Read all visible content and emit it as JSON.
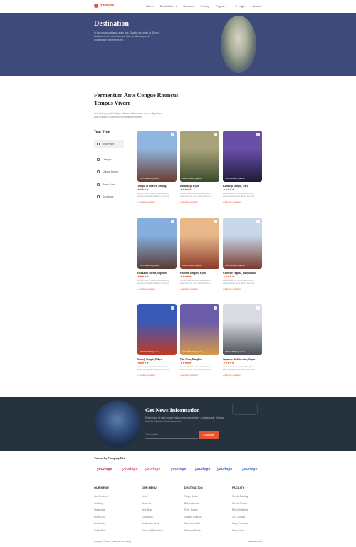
{
  "nav": {
    "logo": "travelyte",
    "menu": [
      {
        "label": "Home",
        "caret": ""
      },
      {
        "label": "Destination",
        "caret": "▾"
      },
      {
        "label": "Services",
        "caret": ""
      },
      {
        "label": "Pricing",
        "caret": ""
      },
      {
        "label": "Pages",
        "caret": "▾"
      }
    ],
    "login": "Login",
    "search": "Search"
  },
  "hero": {
    "title": "Destination",
    "desc": "In leo consequat lacus enim hac. Sagittis sed enim ut. Donec faucibus amet in consectetur. Nam at ullamcorper ut. Scelerisque elementum leo."
  },
  "section": {
    "title": "Fermentum Ante Congue Rhoncus Tempus Viverr",
    "desc": "Amet integer nisl tristique aliquam ullamcorper ut nec dignissim odio tincidunt in bibendum blandit elementum."
  },
  "tour_type": {
    "title": "Tour Type",
    "items": [
      {
        "label": "Best Place",
        "icon": "place-icon"
      },
      {
        "label": "Lifestyle",
        "icon": "lifestyle-icon"
      },
      {
        "label": "Unique Search",
        "icon": "search-icon"
      },
      {
        "label": "Prime Date",
        "icon": "calendar-icon"
      },
      {
        "label": "Adventure",
        "icon": "mountain-icon"
      }
    ]
  },
  "cards": [
    {
      "name": "Temple of Heaven, Beijing",
      "tag": "UNO BARRI Quezon",
      "stars": "★★★★★",
      "desc": "Lacus, diam sit elit condimentum euismod sed nunc libero. Dui nec",
      "explore": "Explore Location",
      "c1": "#8fb6e0",
      "c2": "#6b3b2c"
    },
    {
      "name": "Kinkakuji, Kyoto",
      "tag": "UNO BARRI Quezon",
      "stars": "★★★★★",
      "desc": "Lacus, diam sit elit condimentum euismod sed nunc libero. Dui nec",
      "explore": "Explore Location",
      "c1": "#a8a37a",
      "c2": "#3b4a2a"
    },
    {
      "name": "Kohku-ji Temple, Nara",
      "tag": "UNO BARRI Quezon",
      "stars": "★★★★★",
      "desc": "Lacus, diam sit elit condimentum euismod sed nunc libero. Dui nec",
      "explore": "Explore Location",
      "c1": "#6a4fa8",
      "c2": "#1e1a3a"
    },
    {
      "name": "Hokkaido Shrine, Sapporo",
      "tag": "UNO BARRI Quezon",
      "stars": "★★★★★",
      "desc": "Lacus, diam sit elit condimentum euismod sed nunc libero. Dui nec",
      "explore": "Explore Location",
      "c1": "#86aede",
      "c2": "#5a3a30"
    },
    {
      "name": "Phoenix Temples, Kyoto",
      "tag": "UNO BARRI Quezon",
      "stars": "★★★★★",
      "desc": "Lacus, diam sit elit condimentum euismod sed nunc libero. Dui nec",
      "explore": "Explore Location",
      "c1": "#e8b88a",
      "c2": "#8a3a2a"
    },
    {
      "name": "Chureito Pagoda, Fujiyoshida",
      "tag": "UNO BARRI Quezon",
      "stars": "★★★★★",
      "desc": "Lacus, diam sit elit condimentum euismod sed nunc libero. Dui nec",
      "explore": "Explore Location",
      "c1": "#c8d6ea",
      "c2": "#7a3a2e"
    },
    {
      "name": "Sensoji Temple, Tokyo",
      "tag": "UNO BARRI Quezon",
      "stars": "★★★★★",
      "desc": "Lacus, diam sit elit condimentum euismod sed nunc libero. Dui nec",
      "explore": "Explore Location",
      "c1": "#3a5ab8",
      "c2": "#c23a22"
    },
    {
      "name": "Wat Arun, Bangkok",
      "tag": "UNO BARRI Quezon",
      "stars": "★★★★★",
      "desc": "Lacus, diam sit elit condimentum euismod sed nunc libero. Dui nec",
      "explore": "Explore Location",
      "c1": "#6a5ca8",
      "c2": "#d89a4a"
    },
    {
      "name": "Japanese Architecture, Japan",
      "tag": "UNO BARRI Quezon",
      "stars": "★★★★★",
      "desc": "Lacus, diam sit elit condimentum euismod sed nunc libero. Dui nec",
      "explore": "Explore Location",
      "c1": "#d8dce2",
      "c2": "#4a4e56"
    }
  ],
  "news": {
    "title": "Get News Information",
    "desc": "Erat cursus ut eget ornare ullamcorper consectetur a egestas elit. Viverra lobortis faucibus felis tristique est.",
    "placeholder": "Your email ...",
    "button": "Subscribe"
  },
  "trusted": {
    "title": "Trusted by Company like",
    "logos": [
      {
        "label": "yourlogo",
        "color": "#c0396a"
      },
      {
        "label": "yourlogo",
        "color": "#d44a8a"
      },
      {
        "label": "yourlogo",
        "color": "#e85a8a"
      },
      {
        "label": "yourlogo",
        "color": "#7a5cc8"
      },
      {
        "label": "yourlogo",
        "color": "#4a5ab8"
      },
      {
        "label": "yourlogo",
        "color": "#3a6ac8"
      },
      {
        "label": "yourlogo",
        "color": "#4a7ad8"
      }
    ]
  },
  "footer": {
    "cols": [
      {
        "title": "OUR MENU",
        "links": [
          "Our Services",
          "Our Blog",
          "Testimonial",
          "Pricing List",
          "Destination",
          "Single Post"
        ]
      },
      {
        "title": "OUR MENU",
        "links": [
          "Home",
          "About Us",
          "Best Team",
          "Contact Us",
          "Destination Detail",
          "Video and Promotion"
        ]
      },
      {
        "title": "DESTINATION",
        "links": [
          "Tokyo, Japan",
          "Bali, Indonesia",
          "Paris, France",
          "Sydney, Australia",
          "New York, USA",
          "Florence, Rome"
        ]
      },
      {
        "title": "FACILITY",
        "links": [
          "Simple Booking",
          "Simple Refund",
          "Best Destination",
          "24/7 Contact",
          "Many Promotion",
          "Easy to use"
        ]
      }
    ],
    "copyright": "Copyright © 2023 Travelyte Technology",
    "credit": "Made with love"
  },
  "colors": {
    "accent": "#e8542c",
    "hero": "#3d4a7a",
    "news": "#26323e"
  }
}
